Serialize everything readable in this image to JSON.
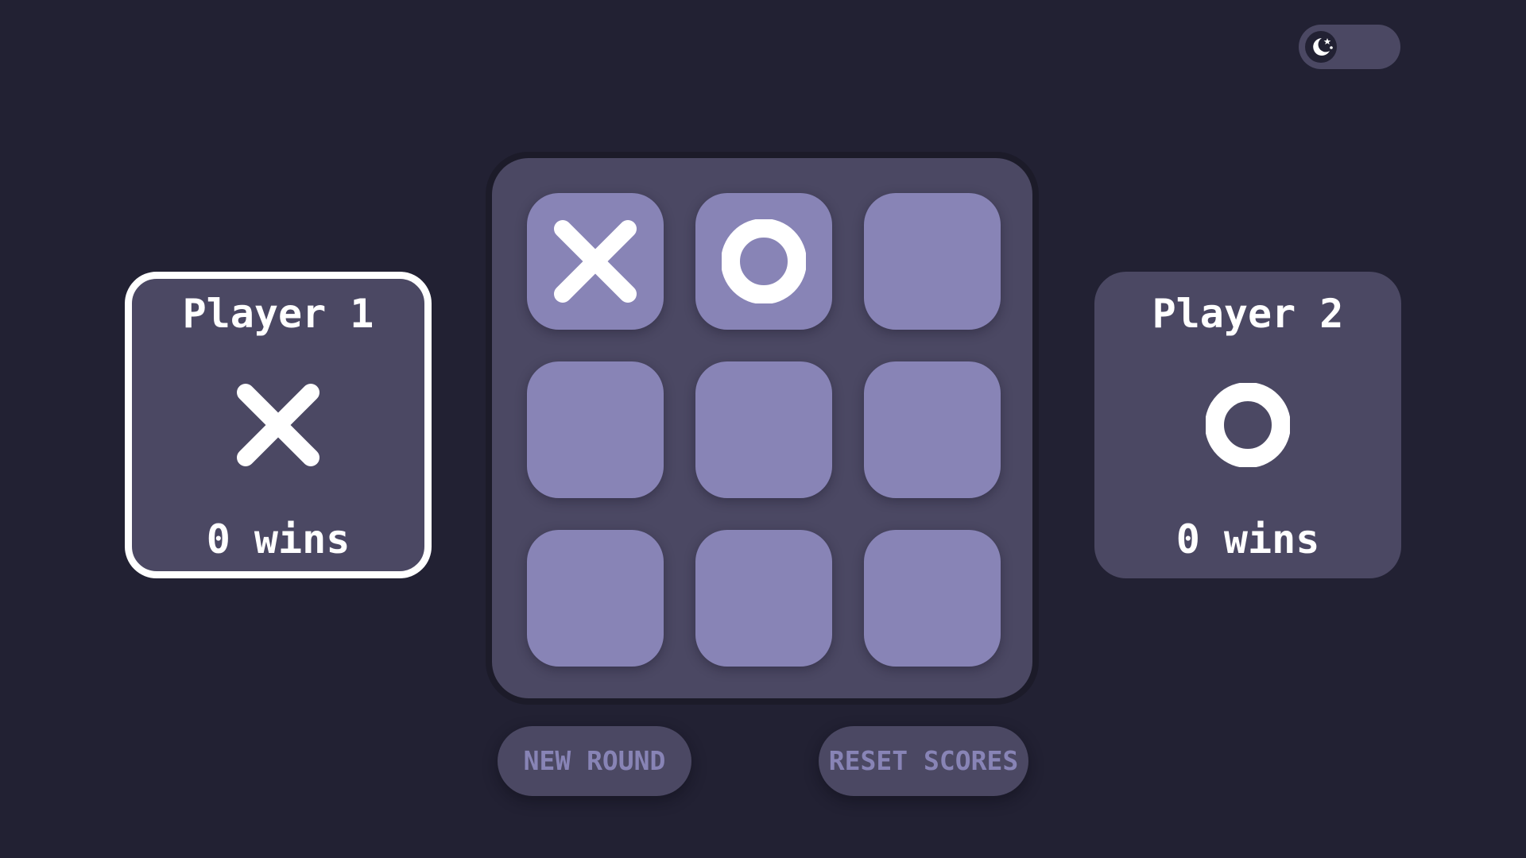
{
  "theme_toggle": {
    "icon": "moon-stars-icon",
    "mode": "dark"
  },
  "players": [
    {
      "name": "Player 1",
      "symbol": "X",
      "wins_label": "0 wins",
      "active": true
    },
    {
      "name": "Player 2",
      "symbol": "O",
      "wins_label": "0 wins",
      "active": false
    }
  ],
  "board": {
    "cells": [
      "X",
      "O",
      "",
      "",
      "",
      "",
      "",
      "",
      ""
    ]
  },
  "actions": {
    "new_round_label": "NEW ROUND",
    "reset_scores_label": "RESET SCORES"
  },
  "colors": {
    "background": "#222133",
    "panel": "#4b4863",
    "cell": "#8884b6",
    "mark": "#ffffff"
  }
}
